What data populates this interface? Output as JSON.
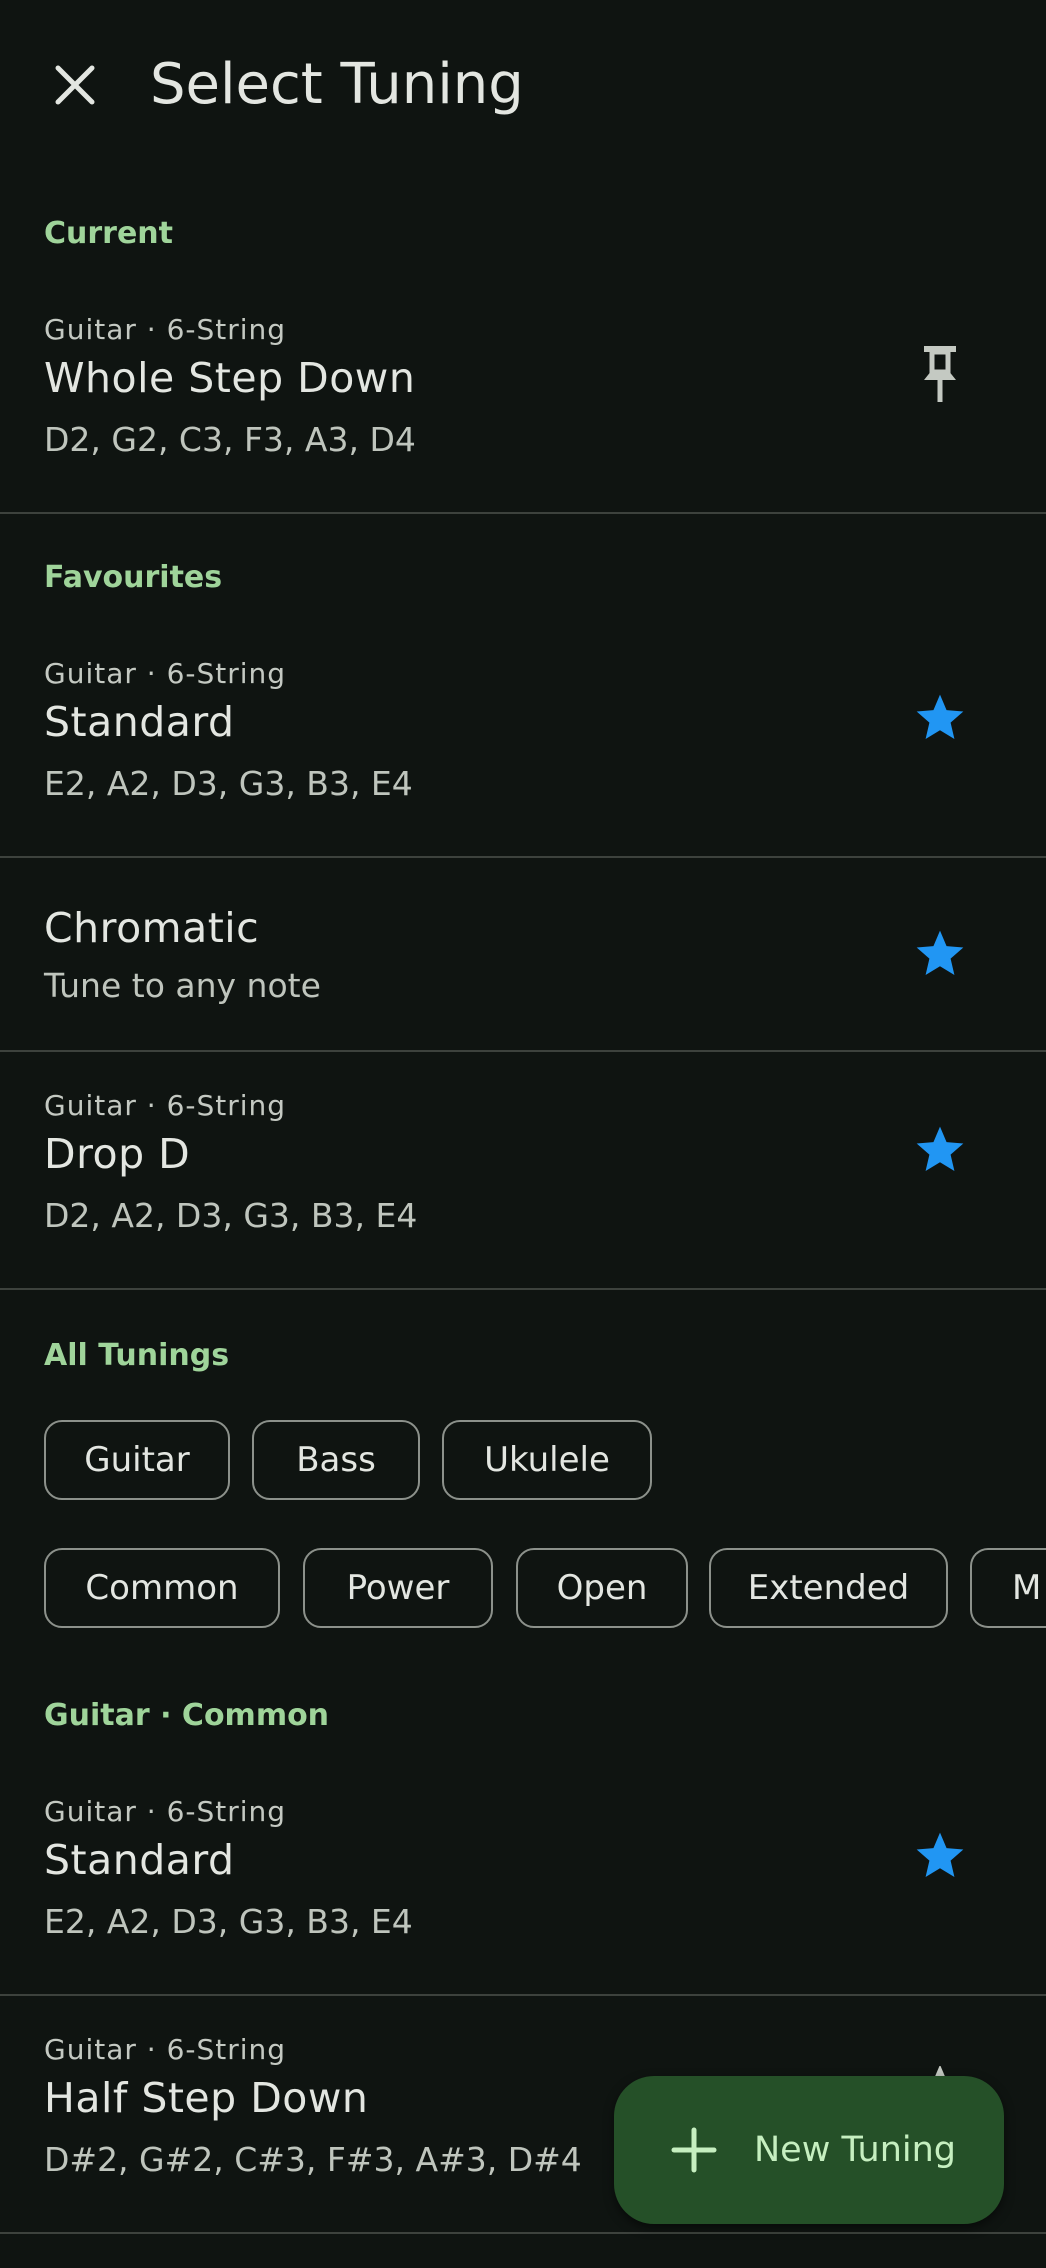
{
  "appbar": {
    "title": "Select Tuning",
    "close_icon": "close-icon"
  },
  "current": {
    "header": "Current",
    "item": {
      "instrument": "Guitar · 6-String",
      "name": "Whole Step Down",
      "notes": "D2, G2, C3, F3, A3, D4",
      "icon": "pin-icon"
    }
  },
  "favourites": {
    "header": "Favourites",
    "items": [
      {
        "instrument": "Guitar · 6-String",
        "name": "Standard",
        "notes": "E2, A2, D3, G3, B3, E4",
        "icon": "star-icon"
      },
      {
        "name": "Chromatic",
        "description": "Tune to any note",
        "icon": "star-icon"
      },
      {
        "instrument": "Guitar · 6-String",
        "name": "Drop D",
        "notes": "D2, A2, D3, G3, B3, E4",
        "icon": "star-icon"
      }
    ]
  },
  "all_tunings": {
    "header": "All Tunings",
    "instrument_chips": [
      "Guitar",
      "Bass",
      "Ukulele"
    ],
    "category_chips": [
      "Common",
      "Power",
      "Open",
      "Extended",
      "M"
    ],
    "group_header": "Guitar · Common",
    "items": [
      {
        "instrument": "Guitar · 6-String",
        "name": "Standard",
        "notes": "E2, A2, D3, G3, B3, E4",
        "icon": "star-icon"
      },
      {
        "instrument": "Guitar · 6-String",
        "name": "Half Step Down",
        "notes": "D#2, G#2, C#3, F#3, A#3, D#4",
        "icon": "star-icon"
      }
    ]
  },
  "fab": {
    "label": "New Tuning",
    "icon": "plus-icon"
  },
  "colors": {
    "background": "#0f1411",
    "accent_green": "#9fd49a",
    "star_blue": "#2196f3",
    "fab_bg": "#255028"
  }
}
